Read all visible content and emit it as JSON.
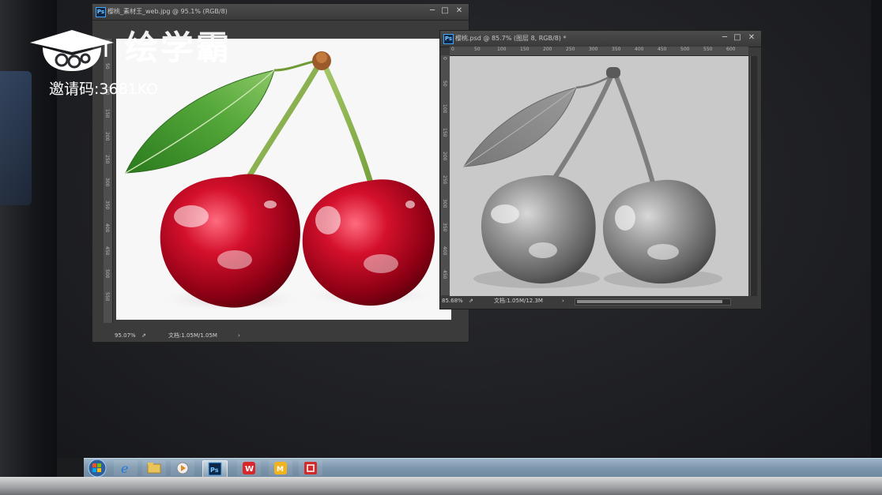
{
  "watermark": {
    "brand_name": "绘学霸",
    "invite_code": "邀请码:3681KO"
  },
  "window_left": {
    "title": "樱桃_素材王_web.jpg @ 95.1% (RGB/8)",
    "zoom": "95.07%",
    "doc_info": "文档:1.05M/1.05M",
    "arrow": "›",
    "ruler_v_ticks": [
      "0",
      "50",
      "100",
      "150",
      "200",
      "250",
      "300",
      "350",
      "400",
      "450",
      "500",
      "550"
    ],
    "canvas_mode": "color"
  },
  "window_right": {
    "title": "樱桃.psd @ 85.7% (图层 8, RGB/8) *",
    "zoom": "85.68%",
    "doc_info": "文档:1.05M/12.3M",
    "arrow": "›",
    "ruler_h_ticks": [
      "0",
      "50",
      "100",
      "150",
      "200",
      "250",
      "300",
      "350",
      "400",
      "450",
      "500",
      "550",
      "600"
    ],
    "ruler_v_ticks": [
      "0",
      "50",
      "100",
      "150",
      "200",
      "250",
      "300",
      "350",
      "400",
      "450"
    ],
    "canvas_mode": "grayscale"
  },
  "window_buttons": {
    "minimize": "─",
    "maximize": "□",
    "close": "✕"
  },
  "taskbar": {
    "items": [
      {
        "name": "start-orb"
      },
      {
        "name": "internet-explorer-icon"
      },
      {
        "name": "file-explorer-icon"
      },
      {
        "name": "media-player-icon"
      },
      {
        "name": "photoshop-icon",
        "label": "Ps",
        "active": true
      },
      {
        "name": "wps-writer-icon",
        "label": "W"
      },
      {
        "name": "video-app-icon",
        "label": "M"
      },
      {
        "name": "red-app-icon"
      }
    ]
  },
  "colors": {
    "ps_accent": "#41a6f5",
    "cherry_red": "#c4122b",
    "leaf_green": "#3e8f2c",
    "taskbar": "#7f98ae"
  }
}
